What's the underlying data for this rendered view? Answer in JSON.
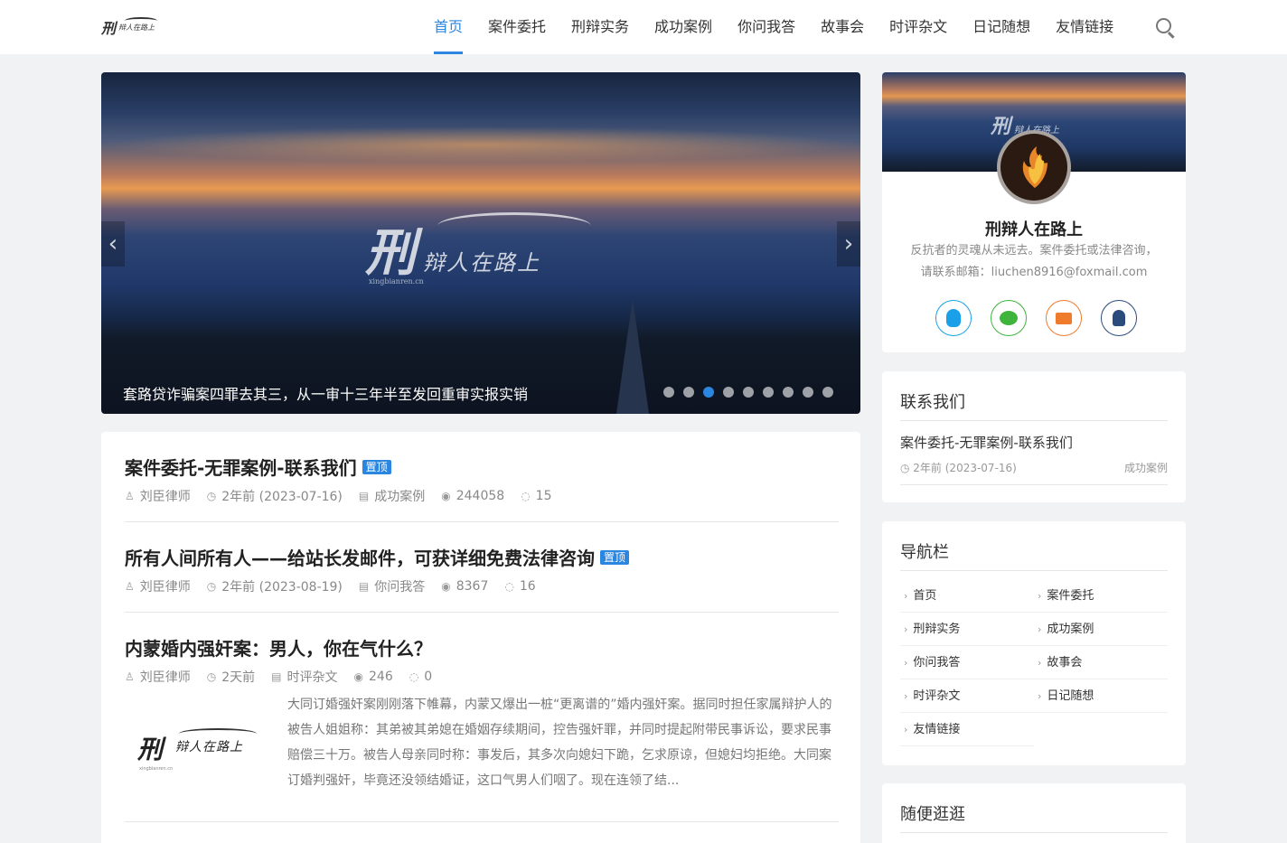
{
  "header": {
    "logo_big": "刑",
    "logo_small": "辩人在路上",
    "nav": [
      "首页",
      "案件委托",
      "刑辩实务",
      "成功案例",
      "你问我答",
      "故事会",
      "时评杂文",
      "日记随想",
      "友情链接"
    ],
    "active_index": 0
  },
  "slider": {
    "watermark_big": "刑",
    "watermark_small": "辩人在路上",
    "watermark_url": "xingbianren.cn",
    "caption": "套路贷诈骗案四罪去其三，从一审十三年半至发回重审实报实销",
    "dot_count": 9,
    "active_dot": 2,
    "prev_icon": "‹",
    "next_icon": "›"
  },
  "posts": [
    {
      "title": "案件委托-无罪案例-联系我们",
      "badge": "置顶",
      "author": "刘臣律师",
      "time": "2年前 (2023-07-16)",
      "category": "成功案例",
      "views": "244058",
      "comments": "15"
    },
    {
      "title": "所有人间所有人——给站长发邮件，可获详细免费法律咨询",
      "badge": "置顶",
      "author": "刘臣律师",
      "time": "2年前 (2023-08-19)",
      "category": "你问我答",
      "views": "8367",
      "comments": "16"
    },
    {
      "title": "内蒙婚内强奸案：男人，你在气什么？",
      "badge": "",
      "author": "刘臣律师",
      "time": "2天前",
      "category": "时评杂文",
      "views": "246",
      "comments": "0",
      "thumb_big": "刑",
      "thumb_small": "辩人在路上",
      "thumb_url": "xingbianren.cn",
      "excerpt": "大同订婚强奸案刚刚落下帷幕，内蒙又爆出一桩“更离谱的”婚内强奸案。据同时担任家属辩护人的被告人姐姐称：其弟被其弟媳在婚姻存续期间，控告强奸罪，并同时提起附带民事诉讼，要求民事赔偿三十万。被告人母亲同时称：事发后，其多次向媳妇下跪，乞求原谅，但媳妇均拒绝。大同案订婚判强奸，毕竟还没领结婚证，这口气男人们咽了。现在连领了结..."
    }
  ],
  "profile": {
    "banner_big": "刑",
    "banner_small": "辩人在路上",
    "name": "刑辩人在路上",
    "desc_line1": "反抗者的灵魂从未远去。案件委托或法律咨询，",
    "desc_line2": "请联系邮箱：liuchen8916@foxmail.com",
    "social_icons": [
      "qq-icon",
      "wechat-icon",
      "mail-icon",
      "user-icon"
    ]
  },
  "contact": {
    "title": "联系我们",
    "post_title": "案件委托-无罪案例-联系我们",
    "time": "2年前 (2023-07-16)",
    "category": "成功案例"
  },
  "navbar": {
    "title": "导航栏",
    "links": [
      "首页",
      "案件委托",
      "刑辩实务",
      "成功案例",
      "你问我答",
      "故事会",
      "时评杂文",
      "日记随想",
      "友情链接"
    ]
  },
  "random": {
    "title": "随便逛逛"
  },
  "colors": {
    "accent": "#2b86e0",
    "qq": "#1aa0e8",
    "wechat": "#3fb43c",
    "mail": "#ef7b2d",
    "user": "#2b4b7c"
  }
}
